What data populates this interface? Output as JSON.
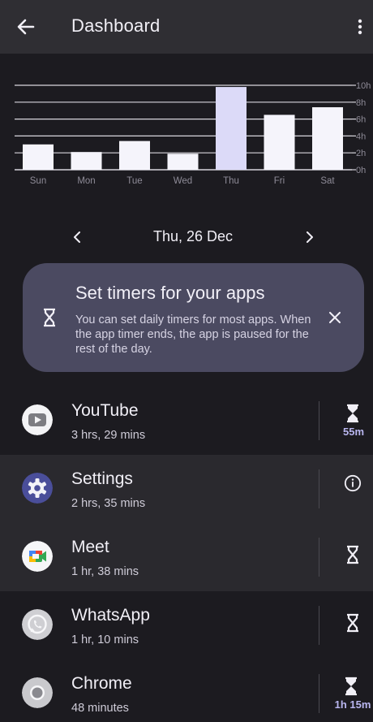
{
  "header": {
    "title": "Dashboard",
    "back_icon": "arrow-left-icon",
    "menu_icon": "more-vert-icon"
  },
  "chart_data": {
    "type": "bar",
    "categories": [
      "Sun",
      "Mon",
      "Tue",
      "Wed",
      "Thu",
      "Fri",
      "Sat"
    ],
    "values": [
      3.0,
      2.1,
      3.4,
      1.9,
      9.8,
      6.5,
      7.4
    ],
    "selected": "Thu",
    "y_ticks": [
      "0h",
      "2h",
      "4h",
      "6h",
      "8h",
      "10h"
    ],
    "ylim": [
      0,
      10
    ],
    "grid": true,
    "colors": {
      "bar": "#f5f4fb",
      "selected_bar": "#dcdaf8",
      "grid": "#d8d6dd",
      "labels": "#8e8b97"
    }
  },
  "date_nav": {
    "date": "Thu, 26 Dec",
    "prev_icon": "chevron-left-icon",
    "next_icon": "chevron-right-icon"
  },
  "timer_card": {
    "title": "Set timers for your apps",
    "body": "You can set daily timers for most apps. When the app timer ends, the app is paused for the rest of the day.",
    "icon": "hourglass-icon",
    "close_icon": "close-icon"
  },
  "apps": [
    {
      "name": "YouTube",
      "time": "3 hrs, 29 mins",
      "action": "hourglass",
      "limit": "55m"
    },
    {
      "name": "Settings",
      "time": "2 hrs, 35 mins",
      "action": "info",
      "limit": ""
    },
    {
      "name": "Meet",
      "time": "1 hr, 38 mins",
      "action": "hourglass",
      "limit": ""
    },
    {
      "name": "WhatsApp",
      "time": "1 hr, 10 mins",
      "action": "hourglass",
      "limit": ""
    },
    {
      "name": "Chrome",
      "time": "48 minutes",
      "action": "hourglass",
      "limit": "1h 15m"
    }
  ],
  "colors": {
    "background": "#1c1b20",
    "topbar": "#2f2e33",
    "card": "#4b4a61",
    "accent": "#b9b6ef"
  }
}
